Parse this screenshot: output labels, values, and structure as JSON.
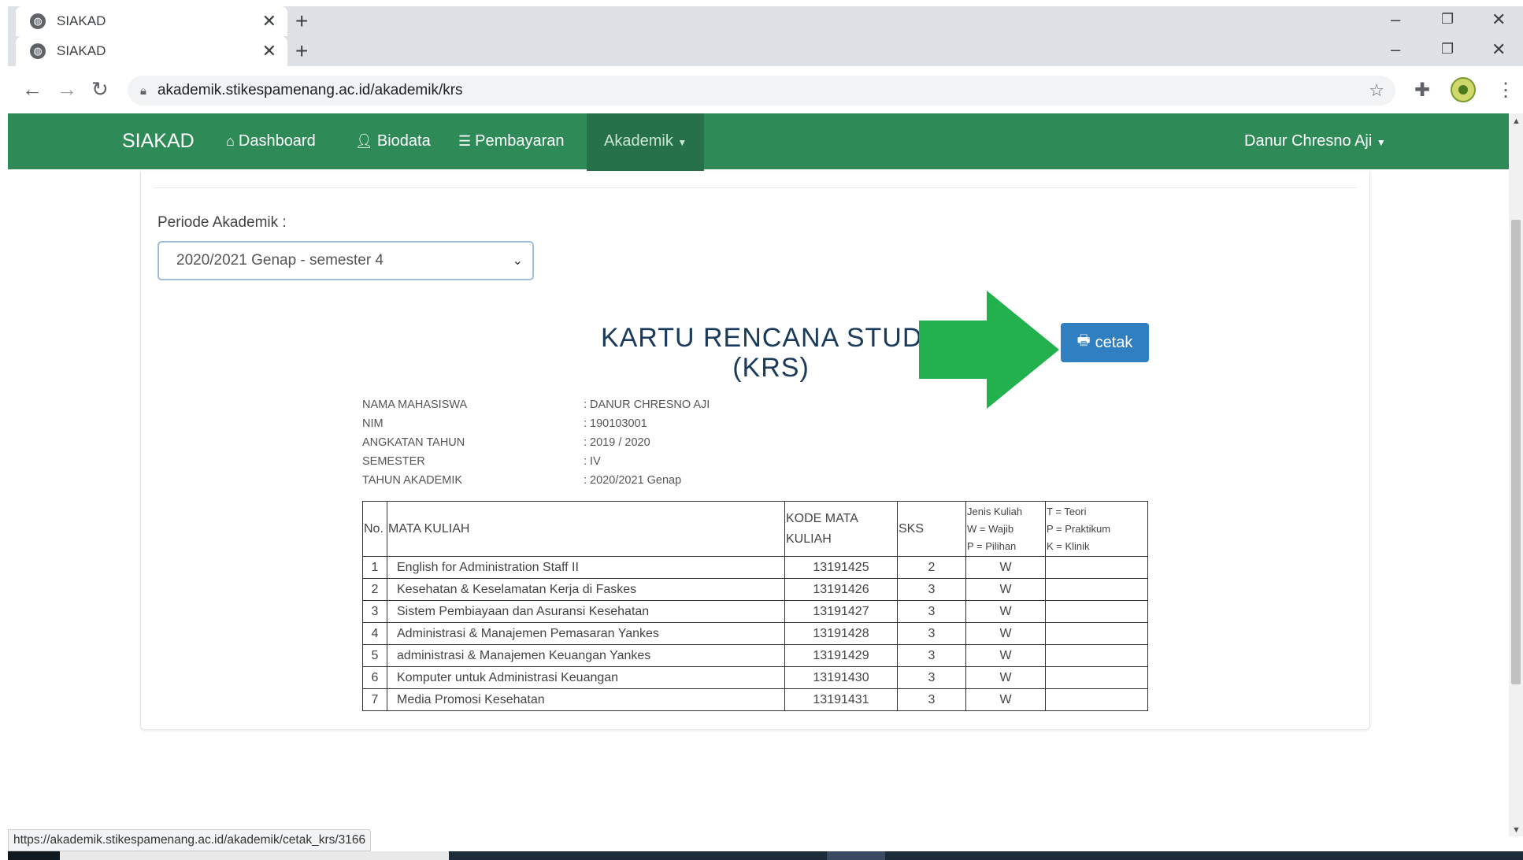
{
  "browser": {
    "tabs": [
      {
        "title": "SIAKAD"
      },
      {
        "title": "SIAKAD"
      }
    ],
    "url": "akademik.stikespamenang.ac.id/akademik/krs",
    "status_url": "https://akademik.stikespamenang.ac.id/akademik/cetak_krs/3166"
  },
  "navbar": {
    "brand": "SIAKAD",
    "links": [
      {
        "label": "Dashboard",
        "icon": "home-icon"
      },
      {
        "label": "Biodata",
        "icon": "user-icon"
      },
      {
        "label": "Pembayaran",
        "icon": "list-icon"
      },
      {
        "label": "Akademik",
        "icon": "caret-down-icon"
      }
    ],
    "user": "Danur Chresno Aji"
  },
  "periode": {
    "label": "Periode Akademik :",
    "selected": "2020/2021 Genap - semester 4"
  },
  "krs": {
    "title_line1": "KARTU RENCANA STUDY",
    "title_line2": "(KRS)",
    "print_label": "cetak",
    "arrow_color": "#22b14c",
    "info": [
      {
        "key": "NAMA MAHASISWA",
        "value": ": DANUR CHRESNO AJI"
      },
      {
        "key": "NIM",
        "value": ": 190103001"
      },
      {
        "key": "ANGKATAN TAHUN",
        "value": ": 2019 / 2020"
      },
      {
        "key": "SEMESTER",
        "value": ": IV"
      },
      {
        "key": "TAHUN AKADEMIK",
        "value": ": 2020/2021 Genap"
      }
    ],
    "table": {
      "headers": {
        "no": "No.",
        "mata_kuliah": "MATA KULIAH",
        "kode": "KODE MATA KULIAH",
        "sks": "SKS",
        "jenis": [
          "Jenis Kuliah",
          "W = Wajib",
          "P = Pilihan"
        ],
        "tipe": [
          "T = Teori",
          "P = Praktikum",
          "K = Klinik"
        ]
      },
      "rows": [
        {
          "no": "1",
          "mk": "English for Administration Staff II",
          "kode": "13191425",
          "sks": "2",
          "jenis": "W",
          "tipe": ""
        },
        {
          "no": "2",
          "mk": "Kesehatan & Keselamatan Kerja di Faskes",
          "kode": "13191426",
          "sks": "3",
          "jenis": "W",
          "tipe": ""
        },
        {
          "no": "3",
          "mk": "Sistem Pembiayaan dan Asuransi Kesehatan",
          "kode": "13191427",
          "sks": "3",
          "jenis": "W",
          "tipe": ""
        },
        {
          "no": "4",
          "mk": "Administrasi & Manajemen Pemasaran Yankes",
          "kode": "13191428",
          "sks": "3",
          "jenis": "W",
          "tipe": ""
        },
        {
          "no": "5",
          "mk": "administrasi & Manajemen Keuangan Yankes",
          "kode": "13191429",
          "sks": "3",
          "jenis": "W",
          "tipe": ""
        },
        {
          "no": "6",
          "mk": "Komputer untuk Administrasi Keuangan",
          "kode": "13191430",
          "sks": "3",
          "jenis": "W",
          "tipe": ""
        },
        {
          "no": "7",
          "mk": "Media Promosi Kesehatan",
          "kode": "13191431",
          "sks": "3",
          "jenis": "W",
          "tipe": ""
        }
      ]
    }
  }
}
